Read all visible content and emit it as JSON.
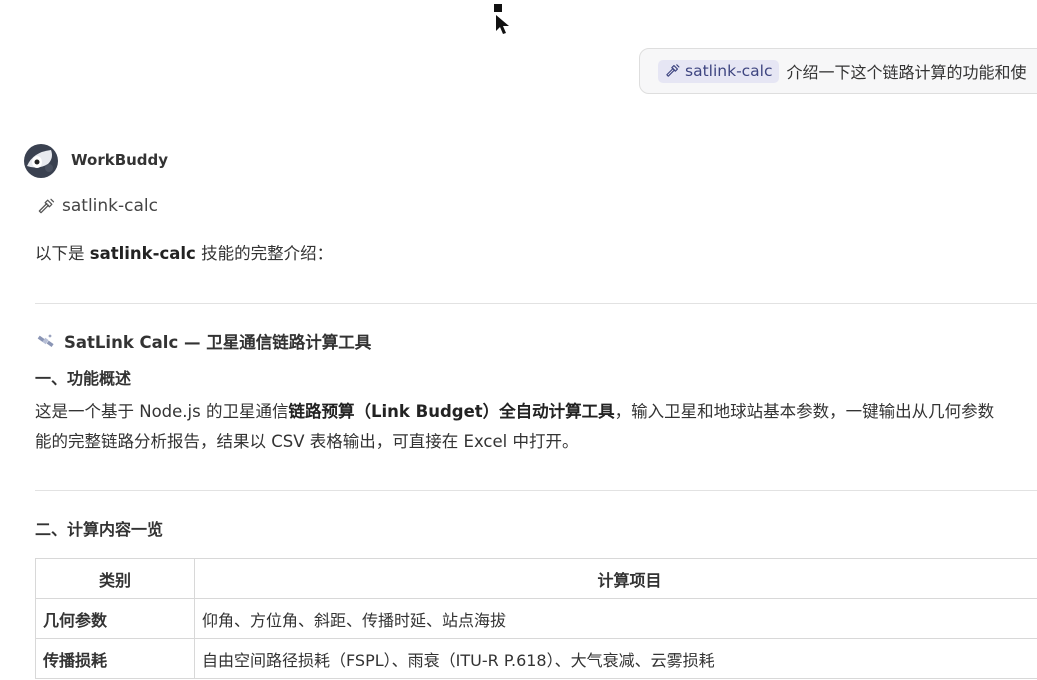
{
  "user_message": {
    "skill_chip": "satlink-calc",
    "text": "介绍一下这个链路计算的功能和使"
  },
  "assistant": {
    "name": "WorkBuddy",
    "skill_tag": "satlink-calc",
    "intro": {
      "prefix": "以下是 ",
      "skill": "satlink-calc",
      "suffix": " 技能的完整介绍："
    },
    "title": "SatLink Calc — 卫星通信链路计算工具",
    "section1": {
      "heading": "一、功能概述",
      "line1_a": "这是一个基于 Node.js 的卫星通信",
      "line1_b": "链路预算（Link Budget）全自动计算工具",
      "line1_c": "，输入卫星和地球站基本参数，一键输出从几何参数",
      "line2": "能的完整链路分析报告，结果以 CSV 表格输出，可直接在 Excel 中打开。"
    },
    "section2": {
      "heading": "二、计算内容一览",
      "table": {
        "headers": [
          "类别",
          "计算项目"
        ],
        "rows": [
          {
            "category": "几何参数",
            "items": "仰角、方位角、斜距、传播时延、站点海拔"
          },
          {
            "category": "传播损耗",
            "items": "自由空间路径损耗（FSPL）、雨衰（ITU-R P.618）、大气衰减、云雾损耗"
          }
        ]
      }
    }
  },
  "icons": {
    "cursor": "mouse-pointer-icon",
    "skill": "hammer-icon",
    "avatar": "workbuddy-avatar-icon",
    "title": "satellite-icon"
  }
}
